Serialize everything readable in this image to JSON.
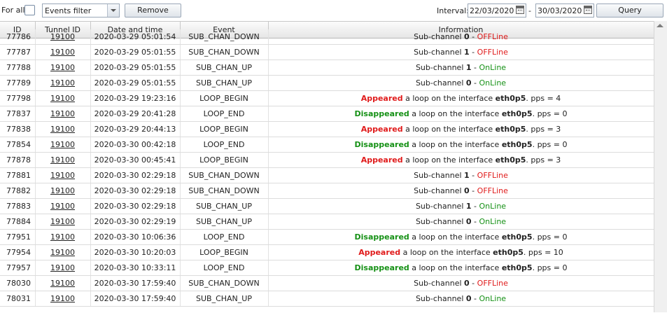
{
  "toolbar": {
    "forall_label": "For all",
    "filter_value": "Events filter",
    "remove_label": "Remove",
    "interval_label": "Interval:",
    "date_from": "22/03/2020",
    "date_sep": "-",
    "date_to": "30/03/2020",
    "query_label": "Query"
  },
  "columns": [
    "ID",
    "Tunnel ID",
    "Date and time",
    "Event",
    "Information"
  ],
  "rows": [
    {
      "id": "77786",
      "tunnel": "19100",
      "dt": "2020-03-29 05:01:54",
      "event": "SUB_CHAN_DOWN",
      "kind": "sub",
      "ch": "0",
      "state": "OFFLine"
    },
    {
      "id": "77787",
      "tunnel": "19100",
      "dt": "2020-03-29 05:01:55",
      "event": "SUB_CHAN_DOWN",
      "kind": "sub",
      "ch": "1",
      "state": "OFFLine"
    },
    {
      "id": "77788",
      "tunnel": "19100",
      "dt": "2020-03-29 05:01:55",
      "event": "SUB_CHAN_UP",
      "kind": "sub",
      "ch": "1",
      "state": "OnLine"
    },
    {
      "id": "77789",
      "tunnel": "19100",
      "dt": "2020-03-29 05:01:55",
      "event": "SUB_CHAN_UP",
      "kind": "sub",
      "ch": "0",
      "state": "OnLine"
    },
    {
      "id": "77798",
      "tunnel": "19100",
      "dt": "2020-03-29 19:23:16",
      "event": "LOOP_BEGIN",
      "kind": "loop",
      "word": "Appeared",
      "iface": "eth0p5",
      "pps": "4"
    },
    {
      "id": "77837",
      "tunnel": "19100",
      "dt": "2020-03-29 20:41:28",
      "event": "LOOP_END",
      "kind": "loop",
      "word": "Disappeared",
      "iface": "eth0p5",
      "pps": "0"
    },
    {
      "id": "77838",
      "tunnel": "19100",
      "dt": "2020-03-29 20:44:13",
      "event": "LOOP_BEGIN",
      "kind": "loop",
      "word": "Appeared",
      "iface": "eth0p5",
      "pps": "3"
    },
    {
      "id": "77854",
      "tunnel": "19100",
      "dt": "2020-03-30 00:42:18",
      "event": "LOOP_END",
      "kind": "loop",
      "word": "Disappeared",
      "iface": "eth0p5",
      "pps": "0"
    },
    {
      "id": "77878",
      "tunnel": "19100",
      "dt": "2020-03-30 00:45:41",
      "event": "LOOP_BEGIN",
      "kind": "loop",
      "word": "Appeared",
      "iface": "eth0p5",
      "pps": "3"
    },
    {
      "id": "77881",
      "tunnel": "19100",
      "dt": "2020-03-30 02:29:18",
      "event": "SUB_CHAN_DOWN",
      "kind": "sub",
      "ch": "1",
      "state": "OFFLine"
    },
    {
      "id": "77882",
      "tunnel": "19100",
      "dt": "2020-03-30 02:29:18",
      "event": "SUB_CHAN_DOWN",
      "kind": "sub",
      "ch": "0",
      "state": "OFFLine"
    },
    {
      "id": "77883",
      "tunnel": "19100",
      "dt": "2020-03-30 02:29:18",
      "event": "SUB_CHAN_UP",
      "kind": "sub",
      "ch": "1",
      "state": "OnLine"
    },
    {
      "id": "77884",
      "tunnel": "19100",
      "dt": "2020-03-30 02:29:19",
      "event": "SUB_CHAN_UP",
      "kind": "sub",
      "ch": "0",
      "state": "OnLine"
    },
    {
      "id": "77951",
      "tunnel": "19100",
      "dt": "2020-03-30 10:06:36",
      "event": "LOOP_END",
      "kind": "loop",
      "word": "Disappeared",
      "iface": "eth0p5",
      "pps": "0"
    },
    {
      "id": "77954",
      "tunnel": "19100",
      "dt": "2020-03-30 10:20:03",
      "event": "LOOP_BEGIN",
      "kind": "loop",
      "word": "Appeared",
      "iface": "eth0p5",
      "pps": "10"
    },
    {
      "id": "77957",
      "tunnel": "19100",
      "dt": "2020-03-30 10:33:11",
      "event": "LOOP_END",
      "kind": "loop",
      "word": "Disappeared",
      "iface": "eth0p5",
      "pps": "0"
    },
    {
      "id": "78030",
      "tunnel": "19100",
      "dt": "2020-03-30 17:59:40",
      "event": "SUB_CHAN_DOWN",
      "kind": "sub",
      "ch": "0",
      "state": "OFFLine"
    },
    {
      "id": "78031",
      "tunnel": "19100",
      "dt": "2020-03-30 17:59:40",
      "event": "SUB_CHAN_UP",
      "kind": "sub",
      "ch": "0",
      "state": "OnLine"
    }
  ],
  "text": {
    "subchannel": "Sub-channel",
    "loop_mid": "a loop on the interface",
    "pps_label": "pps ="
  },
  "colors": {
    "online": "#169116",
    "offline": "#e01b1b"
  }
}
